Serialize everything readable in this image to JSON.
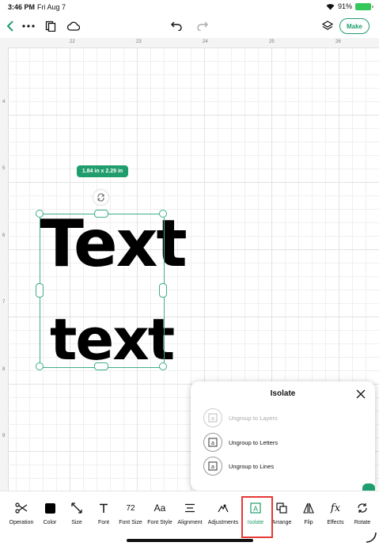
{
  "status_bar": {
    "time": "3:46 PM",
    "date": "Fri Aug 7",
    "battery": "91%"
  },
  "top_toolbar": {
    "make_label": "Make"
  },
  "ruler": {
    "top_marks": [
      "22",
      "23",
      "24",
      "25",
      "26"
    ],
    "left_marks": [
      "4",
      "5",
      "6",
      "7",
      "8",
      "9"
    ]
  },
  "canvas": {
    "size_badge": "1.84 in x 2.29 in",
    "text_line1": "Text",
    "text_line2": "text"
  },
  "isolate_panel": {
    "title": "Isolate",
    "items": [
      {
        "label": "Ungroup to Layers",
        "enabled": false
      },
      {
        "label": "Ungroup to Letters",
        "enabled": true
      },
      {
        "label": "Ungroup to Lines",
        "enabled": true
      }
    ]
  },
  "bottom_toolbar": {
    "items": [
      {
        "label": "Operation",
        "icon": "operation-icon"
      },
      {
        "label": "Color",
        "icon": "color-swatch-icon"
      },
      {
        "label": "Size",
        "icon": "resize-arrows-icon"
      },
      {
        "label": "Font",
        "icon": "font-t-icon"
      },
      {
        "label": "Font Size",
        "icon": "font-size-icon",
        "value": "72"
      },
      {
        "label": "Font Style",
        "icon": "font-style-icon",
        "glyph": "Aa"
      },
      {
        "label": "Alignment",
        "icon": "alignment-icon"
      },
      {
        "label": "Adjustments",
        "icon": "adjustments-icon"
      },
      {
        "label": "Isolate",
        "icon": "isolate-icon",
        "active": true
      },
      {
        "label": "Arrange",
        "icon": "arrange-icon"
      },
      {
        "label": "Flip",
        "icon": "flip-icon"
      },
      {
        "label": "Effects",
        "icon": "effects-fx-icon",
        "glyph": "fx"
      },
      {
        "label": "Rotate",
        "icon": "rotate-icon"
      }
    ]
  },
  "colors": {
    "accent": "#1f9d6c",
    "highlight_frame": "#e53935"
  }
}
